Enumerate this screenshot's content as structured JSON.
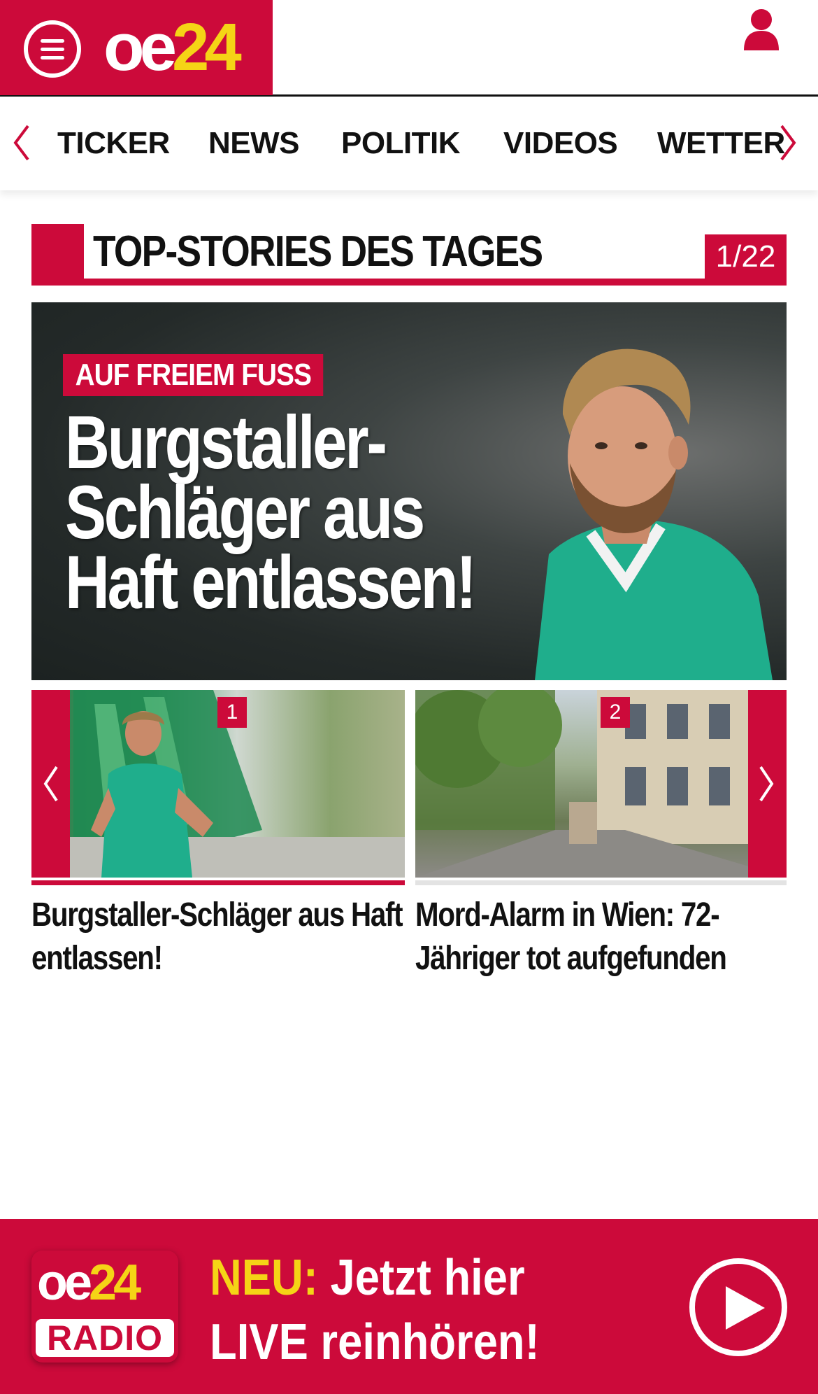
{
  "header": {
    "logo_oe": "oe",
    "logo_num": "24",
    "menu_icon": "hamburger-menu-icon",
    "user_icon": "user-icon"
  },
  "nav": {
    "items": [
      "TICKER",
      "NEWS",
      "POLITIK",
      "VIDEOS",
      "WETTER"
    ],
    "prev_icon": "chevron-left-icon",
    "next_icon": "chevron-right-icon"
  },
  "section": {
    "title": "TOP-STORIES DES TAGES",
    "counter": "1/22"
  },
  "hero": {
    "kicker": "AUF FREIEM FUSS",
    "headline_lines": [
      "Burgstaller-",
      "Schläger aus",
      "Haft entlassen!"
    ]
  },
  "carousel": {
    "cards": [
      {
        "number": "1",
        "title": "Burgstaller-Schläger aus Haft entlassen!"
      },
      {
        "number": "2",
        "title": "Mord-Alarm in Wien: 72-Jähriger tot aufgefunden"
      }
    ]
  },
  "radio": {
    "logo_oe": "oe",
    "logo_num": "24",
    "logo_label": "RADIO",
    "neu": "NEU:",
    "line1": "Jetzt hier",
    "line2": "LIVE reinhören!"
  },
  "colors": {
    "brand_red": "#cc0a3a",
    "brand_yellow": "#f5d416"
  }
}
